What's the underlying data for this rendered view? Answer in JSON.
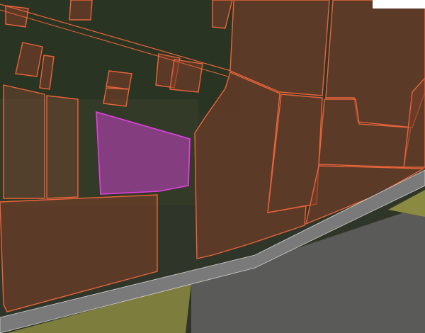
{
  "map": {
    "layer": "satellite-imagery",
    "features": {
      "parcel_outline_color": "#e8643a",
      "parcel_fill_color": "#7a3e2a",
      "selected_parcel_fill": "#a0409c",
      "selected_parcel_stroke": "#e040e0",
      "road_color": "#7a7a7a",
      "field_yellow": "#8a8a40",
      "vegetation_dark": "#2f3a26"
    },
    "selected_parcel": "highlighted",
    "overlay_box": ""
  }
}
